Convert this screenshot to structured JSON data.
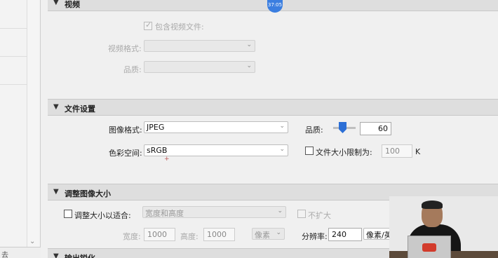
{
  "timer_badge": "37:05",
  "sidebar": {
    "bottom_text": "去"
  },
  "video_section": {
    "title": "视频",
    "include_video_label": "包含视频文件:",
    "include_video_checked": true,
    "video_format_label": "视频格式:",
    "video_format_value": "",
    "quality_label": "品质:",
    "quality_value": ""
  },
  "file_settings": {
    "title": "文件设置",
    "image_format_label": "图像格式:",
    "image_format_value": "JPEG",
    "quality_label": "品质:",
    "quality_slider_value": 60,
    "quality_value": "60",
    "color_space_label": "色彩空间:",
    "color_space_value": "sRGB",
    "limit_size_label": "文件大小限制为:",
    "limit_size_checked": false,
    "limit_size_value": "100",
    "limit_size_unit": "K"
  },
  "resize": {
    "title": "调整图像大小",
    "resize_to_fit_label": "调整大小以适合:",
    "resize_to_fit_checked": false,
    "resize_mode_value": "宽度和高度",
    "dont_enlarge_label": "不扩大",
    "dont_enlarge_checked": false,
    "width_label": "宽度:",
    "width_value": "1000",
    "height_label": "高度:",
    "height_value": "1000",
    "unit_value": "像素",
    "resolution_label": "分辨率:",
    "resolution_value": "240",
    "resolution_unit_value": "像素/英寸"
  },
  "output_sharpening": {
    "title": "输出锐化"
  }
}
